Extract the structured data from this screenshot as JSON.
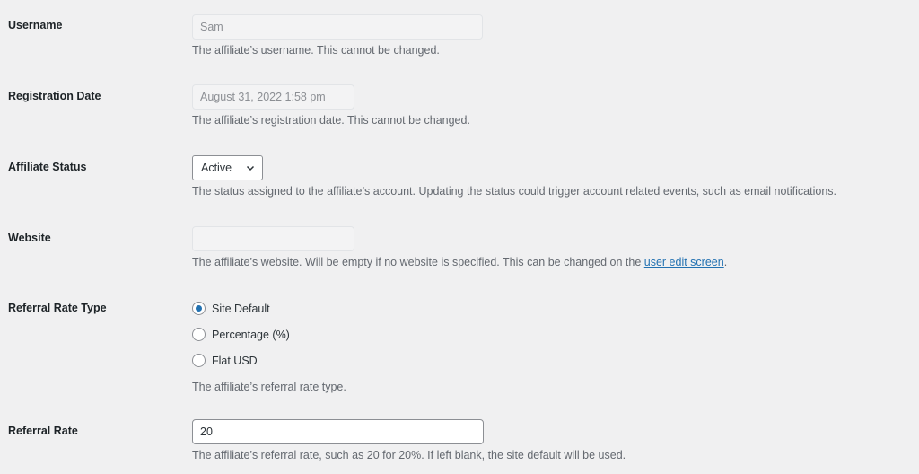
{
  "fields": {
    "username": {
      "label": "Username",
      "value": "Sam",
      "description": "The affiliate’s username. This cannot be changed."
    },
    "registration_date": {
      "label": "Registration Date",
      "value": "August 31, 2022 1:58 pm",
      "description": "The affiliate’s registration date. This cannot be changed."
    },
    "affiliate_status": {
      "label": "Affiliate Status",
      "selected": "Active",
      "description": "The status assigned to the affiliate’s account. Updating the status could trigger account related events, such as email notifications."
    },
    "website": {
      "label": "Website",
      "value": "",
      "description_prefix": "The affiliate’s website. Will be empty if no website is specified. This can be changed on the ",
      "link_text": "user edit screen",
      "description_suffix": "."
    },
    "referral_rate_type": {
      "label": "Referral Rate Type",
      "options": [
        {
          "label": "Site Default",
          "checked": true
        },
        {
          "label": "Percentage (%)",
          "checked": false
        },
        {
          "label": "Flat USD",
          "checked": false
        }
      ],
      "description": "The affiliate’s referral rate type."
    },
    "referral_rate": {
      "label": "Referral Rate",
      "value": "20",
      "description": "The affiliate’s referral rate, such as 20 for 20%. If left blank, the site default will be used."
    }
  },
  "colors": {
    "accent": "#2271b1",
    "background": "#f0f0f1",
    "description_text": "#646970"
  }
}
